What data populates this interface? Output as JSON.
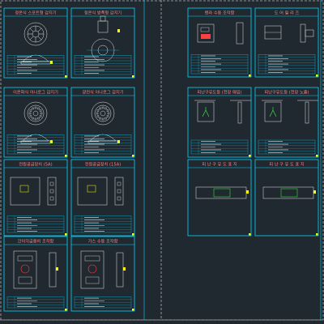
{
  "sheets": {
    "left": [
      {
        "title": "정온식 스포트형 감지기",
        "rows": 7,
        "kind": "round-detector",
        "variant": "wheel"
      },
      {
        "title": "정온식 방폭형 감지기",
        "rows": 7,
        "kind": "explosion-proof"
      },
      {
        "title": "이온화식 아나로그 감지기",
        "rows": 7,
        "kind": "round-detector",
        "variant": "rings"
      },
      {
        "title": "광전식 아나로그 감지기",
        "rows": 7,
        "kind": "round-detector",
        "variant": "rings"
      },
      {
        "title": "전원공급장치 (5A)",
        "rows": 6,
        "kind": "power-box"
      },
      {
        "title": "전원공급장치 (15A)",
        "rows": 6,
        "kind": "power-box"
      },
      {
        "title": "간이각급용비 조작함",
        "rows": 4,
        "kind": "control-box"
      },
      {
        "title": "가스 수동 조작함",
        "rows": 4,
        "kind": "control-box"
      }
    ],
    "right": [
      {
        "title": "랜라 수동 조작함",
        "rows": 7,
        "kind": "panel-front"
      },
      {
        "title": "도 어 릴 리 즈",
        "rows": 7,
        "kind": "door-release"
      },
      {
        "title": "피난구유도등 (천장 매입)",
        "rows": 5,
        "kind": "exit-sign"
      },
      {
        "title": "피난구유도등 (천장 노출)",
        "rows": 5,
        "kind": "exit-sign"
      },
      {
        "title": "피 난 구 유 도 표 지",
        "rows": 0,
        "kind": "exit-plate"
      },
      {
        "title": "피 난 구 유 도 표 지",
        "rows": 0,
        "kind": "exit-plate"
      }
    ]
  },
  "colors": {
    "background": "#202830",
    "frame": "#00d8ff",
    "title_text": "#ff8080",
    "drawing": "#e8e8e8",
    "accent": "#ffff00",
    "dashed": "#b0b0b0"
  }
}
